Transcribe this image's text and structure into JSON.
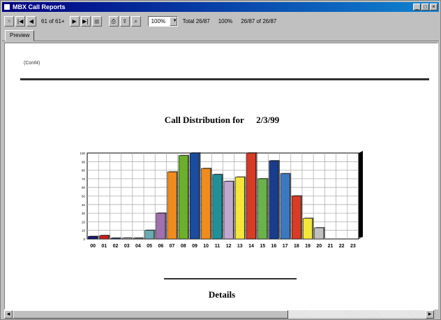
{
  "window": {
    "title": "MBX Call Reports",
    "controls": [
      "_",
      "□",
      "×"
    ]
  },
  "toolbar": {
    "page_label": "61 of 61+",
    "total_label": "Total 26/87",
    "percent_label": "100%",
    "range_label": "26/87 of 26/87",
    "zoom_value": "100%"
  },
  "tabs": [
    {
      "label": "Preview"
    }
  ],
  "report": {
    "id_text": "(Conf4)",
    "title_prefix": "Call Distribution for",
    "title_date": "2/3/99",
    "details_heading": "Details"
  },
  "colors": {
    "titlebar": "#000080",
    "chart_frame": "#000000",
    "grid": "#b0b0b0"
  },
  "chart_data": {
    "type": "bar",
    "title": "Call Distribution for 2/3/99",
    "categories": [
      "00",
      "01",
      "02",
      "03",
      "04",
      "05",
      "06",
      "07",
      "08",
      "09",
      "10",
      "11",
      "12",
      "13",
      "14",
      "15",
      "16",
      "17",
      "18",
      "19",
      "20",
      "21",
      "22",
      "23"
    ],
    "values": [
      3,
      4,
      1,
      1,
      1,
      10,
      30,
      78,
      97,
      100,
      82,
      75,
      67,
      72,
      100,
      70,
      91,
      76,
      50,
      24,
      13,
      0,
      0,
      0
    ],
    "bar_colors": [
      "#1a1a7a",
      "#d02020",
      "#2a5db0",
      "#d0d0d0",
      "#909090",
      "#6aaab0",
      "#a070b0",
      "#f08c1e",
      "#6ab02a",
      "#1a4ca0",
      "#f08c1e",
      "#20909a",
      "#c0a8d0",
      "#f5e63a",
      "#d83c24",
      "#6ab24a",
      "#1a3c8c",
      "#3c78c0",
      "#d83c24",
      "#f5e63a",
      "#c0c0c0",
      "#c0c0c0",
      "#c0c0c0",
      "#c0c0c0"
    ],
    "ylim": [
      0,
      100
    ],
    "grid": true,
    "legend": "none"
  }
}
